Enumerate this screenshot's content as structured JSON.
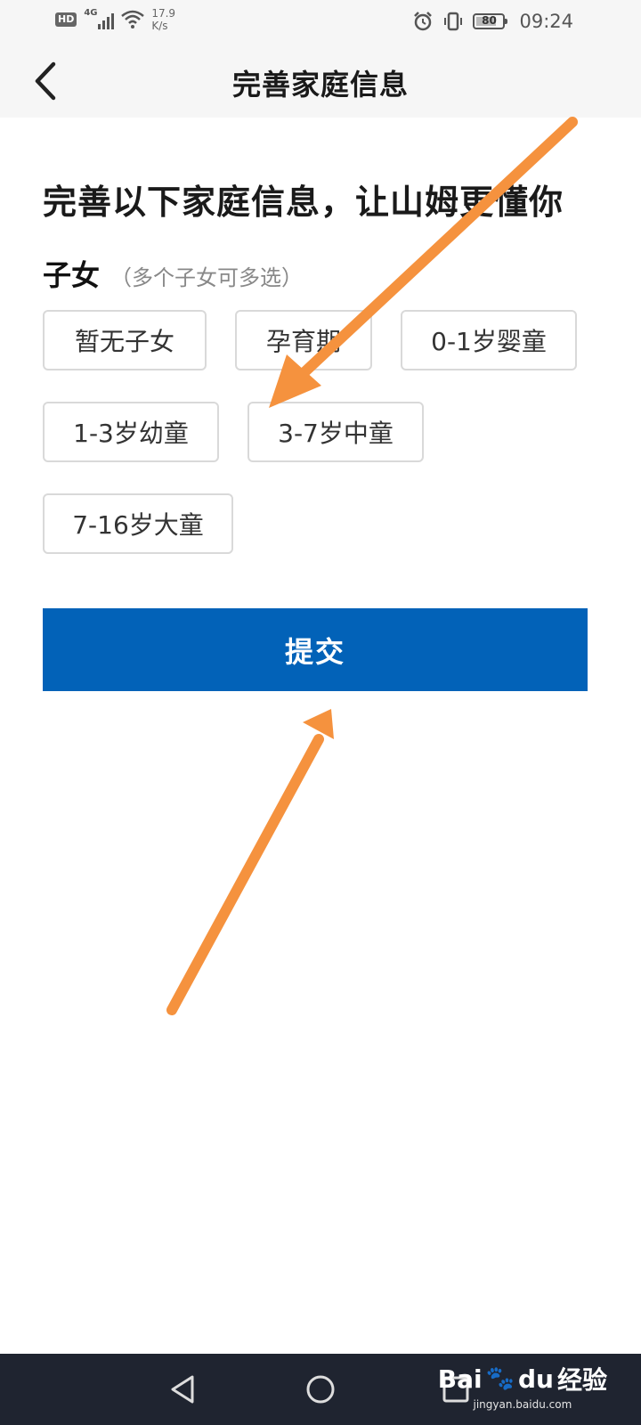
{
  "status_bar": {
    "hd_badge": "HD",
    "network": "4G",
    "speed_value": "17.9",
    "speed_unit": "K/s",
    "battery_level": "80",
    "battery_fraction": 0.8,
    "time": "09:24",
    "icons": [
      "signal-icon",
      "wifi-icon",
      "alarm-icon",
      "vibrate-icon",
      "battery-icon"
    ]
  },
  "header": {
    "title": "完善家庭信息",
    "back_icon": "chevron-left-icon"
  },
  "intro": "完善以下家庭信息，让山姆更懂你",
  "children_section": {
    "title": "子女",
    "hint": "（多个子女可多选）",
    "options": [
      {
        "label": "暂无子女"
      },
      {
        "label": "孕育期"
      },
      {
        "label": "0-1岁婴童"
      },
      {
        "label": "1-3岁幼童"
      },
      {
        "label": "3-7岁中童"
      },
      {
        "label": "7-16岁大童"
      }
    ]
  },
  "submit_label": "提交",
  "system_nav": {
    "buttons": [
      "back-triangle-icon",
      "home-circle-icon",
      "recents-square-icon"
    ]
  },
  "watermark": {
    "brand_a": "Bai",
    "brand_b": "du",
    "brand_c": "经验",
    "url": "jingyan.baidu.com"
  },
  "colors": {
    "primary": "#0262b8",
    "annotation_arrow": "#f5923e",
    "option_border": "#d9d9d9",
    "nav_bar": "#1f2430"
  }
}
